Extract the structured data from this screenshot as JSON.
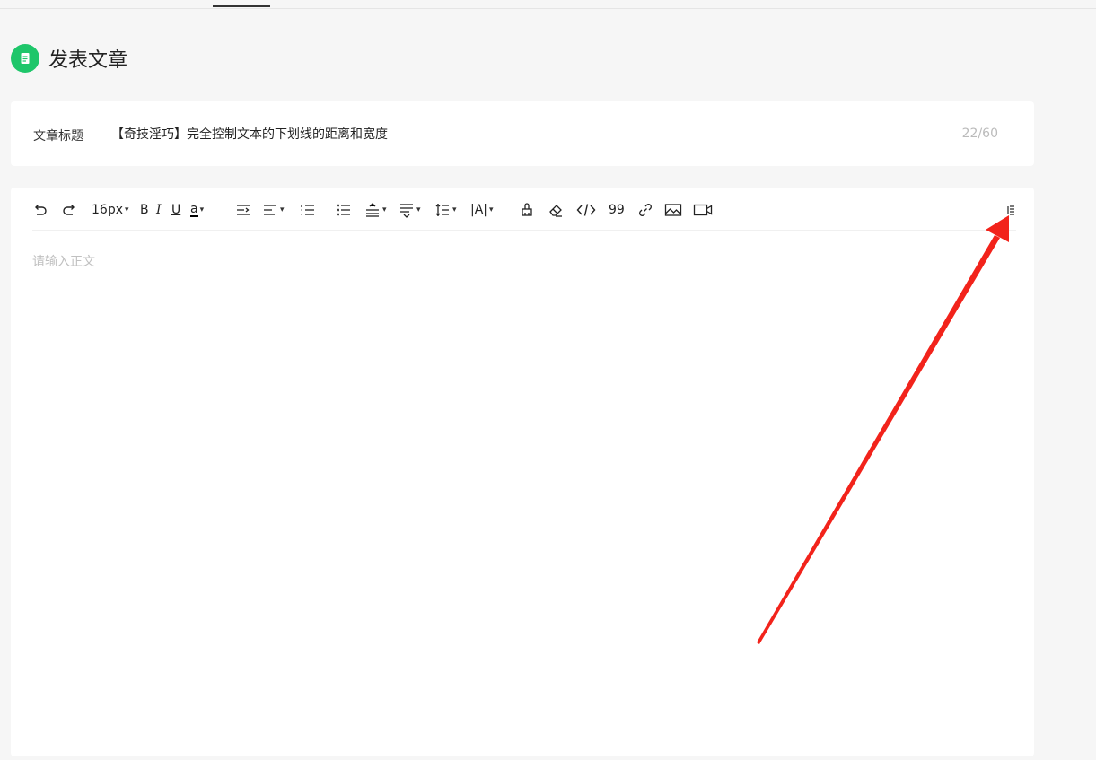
{
  "page": {
    "title": "发表文章"
  },
  "title_field": {
    "label": "文章标题",
    "value": "【奇技淫巧】完全控制文本的下划线的距离和宽度",
    "counter": "22/60"
  },
  "toolbar": {
    "font_size": "16px",
    "bold": "B",
    "italic": "I",
    "underline": "U",
    "font_color": "a",
    "letter_spacing": "|A|",
    "quote": "99"
  },
  "editor": {
    "placeholder": "请输入正文"
  },
  "colors": {
    "accent": "#1ec66a",
    "annotation_arrow": "#f2231b"
  }
}
